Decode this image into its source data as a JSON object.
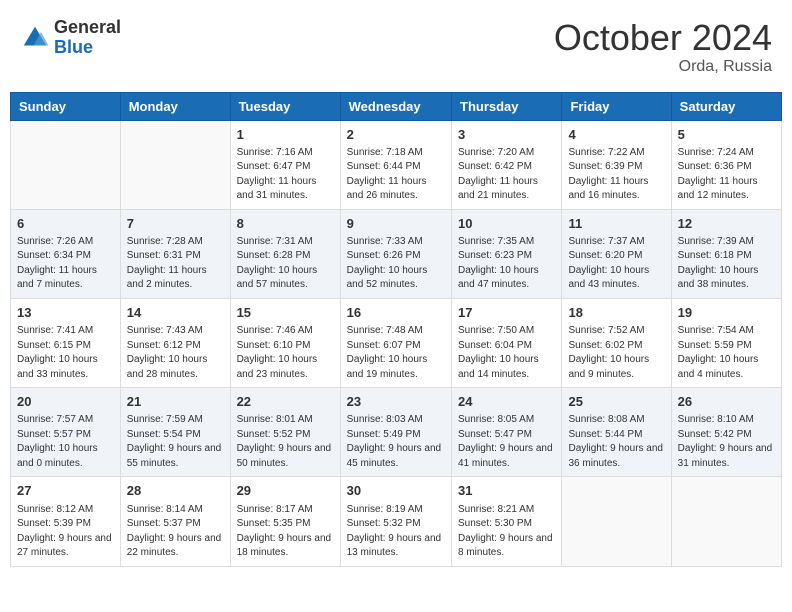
{
  "header": {
    "logo": {
      "general": "General",
      "blue": "Blue"
    },
    "month_title": "October 2024",
    "location": "Orda, Russia"
  },
  "days_of_week": [
    "Sunday",
    "Monday",
    "Tuesday",
    "Wednesday",
    "Thursday",
    "Friday",
    "Saturday"
  ],
  "weeks": [
    {
      "shaded": false,
      "days": [
        {
          "num": "",
          "info": ""
        },
        {
          "num": "",
          "info": ""
        },
        {
          "num": "1",
          "info": "Sunrise: 7:16 AM\nSunset: 6:47 PM\nDaylight: 11 hours and 31 minutes."
        },
        {
          "num": "2",
          "info": "Sunrise: 7:18 AM\nSunset: 6:44 PM\nDaylight: 11 hours and 26 minutes."
        },
        {
          "num": "3",
          "info": "Sunrise: 7:20 AM\nSunset: 6:42 PM\nDaylight: 11 hours and 21 minutes."
        },
        {
          "num": "4",
          "info": "Sunrise: 7:22 AM\nSunset: 6:39 PM\nDaylight: 11 hours and 16 minutes."
        },
        {
          "num": "5",
          "info": "Sunrise: 7:24 AM\nSunset: 6:36 PM\nDaylight: 11 hours and 12 minutes."
        }
      ]
    },
    {
      "shaded": true,
      "days": [
        {
          "num": "6",
          "info": "Sunrise: 7:26 AM\nSunset: 6:34 PM\nDaylight: 11 hours and 7 minutes."
        },
        {
          "num": "7",
          "info": "Sunrise: 7:28 AM\nSunset: 6:31 PM\nDaylight: 11 hours and 2 minutes."
        },
        {
          "num": "8",
          "info": "Sunrise: 7:31 AM\nSunset: 6:28 PM\nDaylight: 10 hours and 57 minutes."
        },
        {
          "num": "9",
          "info": "Sunrise: 7:33 AM\nSunset: 6:26 PM\nDaylight: 10 hours and 52 minutes."
        },
        {
          "num": "10",
          "info": "Sunrise: 7:35 AM\nSunset: 6:23 PM\nDaylight: 10 hours and 47 minutes."
        },
        {
          "num": "11",
          "info": "Sunrise: 7:37 AM\nSunset: 6:20 PM\nDaylight: 10 hours and 43 minutes."
        },
        {
          "num": "12",
          "info": "Sunrise: 7:39 AM\nSunset: 6:18 PM\nDaylight: 10 hours and 38 minutes."
        }
      ]
    },
    {
      "shaded": false,
      "days": [
        {
          "num": "13",
          "info": "Sunrise: 7:41 AM\nSunset: 6:15 PM\nDaylight: 10 hours and 33 minutes."
        },
        {
          "num": "14",
          "info": "Sunrise: 7:43 AM\nSunset: 6:12 PM\nDaylight: 10 hours and 28 minutes."
        },
        {
          "num": "15",
          "info": "Sunrise: 7:46 AM\nSunset: 6:10 PM\nDaylight: 10 hours and 23 minutes."
        },
        {
          "num": "16",
          "info": "Sunrise: 7:48 AM\nSunset: 6:07 PM\nDaylight: 10 hours and 19 minutes."
        },
        {
          "num": "17",
          "info": "Sunrise: 7:50 AM\nSunset: 6:04 PM\nDaylight: 10 hours and 14 minutes."
        },
        {
          "num": "18",
          "info": "Sunrise: 7:52 AM\nSunset: 6:02 PM\nDaylight: 10 hours and 9 minutes."
        },
        {
          "num": "19",
          "info": "Sunrise: 7:54 AM\nSunset: 5:59 PM\nDaylight: 10 hours and 4 minutes."
        }
      ]
    },
    {
      "shaded": true,
      "days": [
        {
          "num": "20",
          "info": "Sunrise: 7:57 AM\nSunset: 5:57 PM\nDaylight: 10 hours and 0 minutes."
        },
        {
          "num": "21",
          "info": "Sunrise: 7:59 AM\nSunset: 5:54 PM\nDaylight: 9 hours and 55 minutes."
        },
        {
          "num": "22",
          "info": "Sunrise: 8:01 AM\nSunset: 5:52 PM\nDaylight: 9 hours and 50 minutes."
        },
        {
          "num": "23",
          "info": "Sunrise: 8:03 AM\nSunset: 5:49 PM\nDaylight: 9 hours and 45 minutes."
        },
        {
          "num": "24",
          "info": "Sunrise: 8:05 AM\nSunset: 5:47 PM\nDaylight: 9 hours and 41 minutes."
        },
        {
          "num": "25",
          "info": "Sunrise: 8:08 AM\nSunset: 5:44 PM\nDaylight: 9 hours and 36 minutes."
        },
        {
          "num": "26",
          "info": "Sunrise: 8:10 AM\nSunset: 5:42 PM\nDaylight: 9 hours and 31 minutes."
        }
      ]
    },
    {
      "shaded": false,
      "days": [
        {
          "num": "27",
          "info": "Sunrise: 8:12 AM\nSunset: 5:39 PM\nDaylight: 9 hours and 27 minutes."
        },
        {
          "num": "28",
          "info": "Sunrise: 8:14 AM\nSunset: 5:37 PM\nDaylight: 9 hours and 22 minutes."
        },
        {
          "num": "29",
          "info": "Sunrise: 8:17 AM\nSunset: 5:35 PM\nDaylight: 9 hours and 18 minutes."
        },
        {
          "num": "30",
          "info": "Sunrise: 8:19 AM\nSunset: 5:32 PM\nDaylight: 9 hours and 13 minutes."
        },
        {
          "num": "31",
          "info": "Sunrise: 8:21 AM\nSunset: 5:30 PM\nDaylight: 9 hours and 8 minutes."
        },
        {
          "num": "",
          "info": ""
        },
        {
          "num": "",
          "info": ""
        }
      ]
    }
  ]
}
